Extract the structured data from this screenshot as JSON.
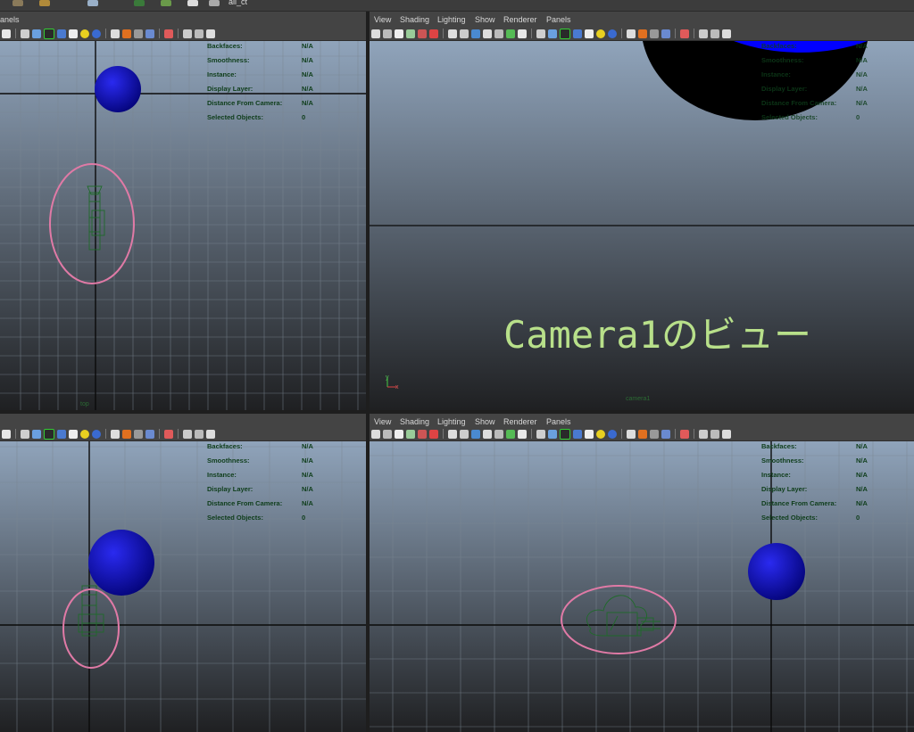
{
  "title": {
    "panels_label": "anels",
    "filename": "all_ct"
  },
  "menus": [
    "View",
    "Shading",
    "Lighting",
    "Show",
    "Renderer",
    "Panels"
  ],
  "hud": {
    "labels": [
      "Backfaces:",
      "Smoothness:",
      "Instance:",
      "Display Layer:",
      "Distance From Camera:",
      "Selected Objects:"
    ],
    "values": [
      "N/A",
      "N/A",
      "N/A",
      "N/A",
      "N/A",
      "0"
    ]
  },
  "panes": {
    "top_right": {
      "overlay": "Camera1のビュー",
      "camera_label": "camera1",
      "axis_y": "y",
      "axis_x": "x"
    },
    "top_left": {
      "view_label": "top"
    }
  },
  "colors": {
    "sky_top": "#8fa3ba",
    "sky_bottom": "#1c1d1f",
    "grid_line": "#6e7a86",
    "axis_line": "#0a0a0a",
    "sphere": "#1010c8",
    "highlight_ellipse": "#e07aa6",
    "camera_wire": "#1f6a2a",
    "overlay_text": "#b8e08a"
  },
  "icons": [
    "move-icon",
    "select-icon",
    "texture-icon",
    "light-icon",
    "render-icon",
    "shade-icon",
    "wire-icon",
    "smooth-icon",
    "box-icon",
    "checker-icon",
    "camera-icon"
  ]
}
